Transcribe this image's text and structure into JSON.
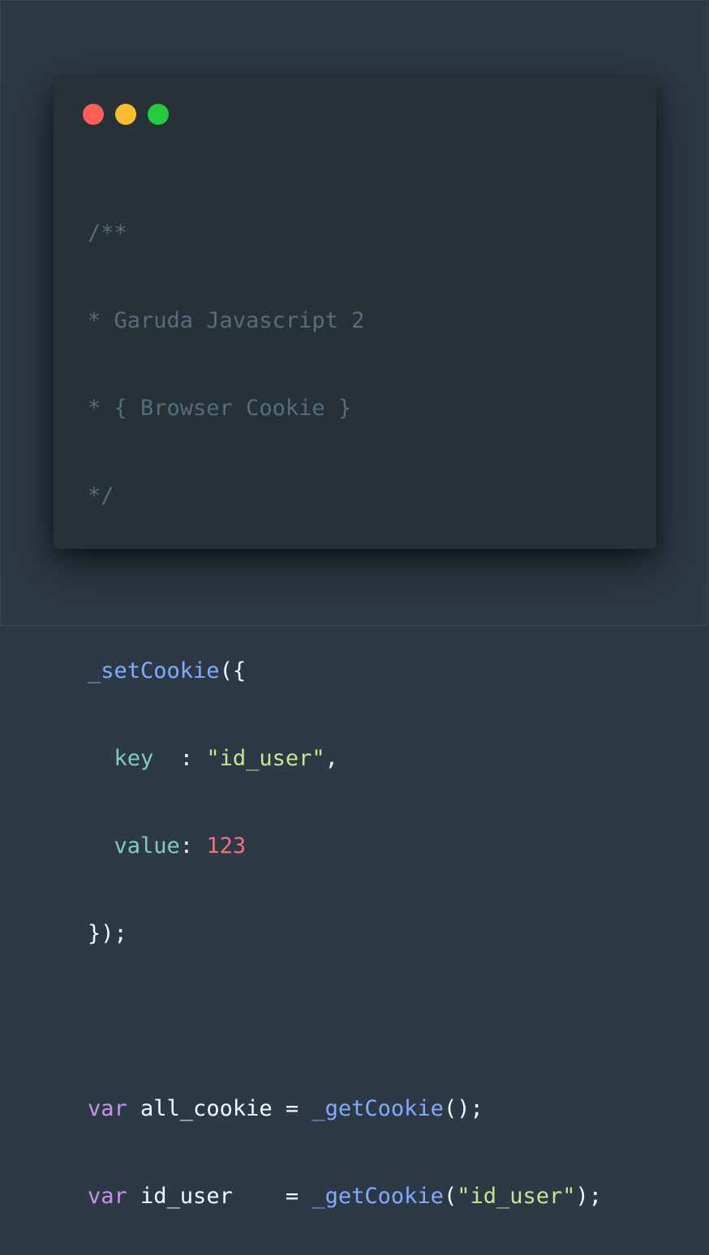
{
  "window": {
    "controls": [
      "close",
      "minimize",
      "maximize"
    ],
    "colors": {
      "close": "#ff5f56",
      "minimize": "#ffbd2e",
      "maximize": "#27c93f",
      "background": "#263238",
      "page_background": "#2e3946"
    }
  },
  "code": {
    "comment_open": "/**",
    "comment_line1": "* Garuda Javascript 2",
    "comment_line2": "* { Browser Cookie }",
    "comment_close": "*/",
    "set_fn": "_setCookie",
    "set_open": "({",
    "key_prop": "key",
    "key_colon": "  : ",
    "key_value": "\"id_user\"",
    "key_comma": ",",
    "value_prop": "value",
    "value_colon": ": ",
    "value_value": "123",
    "set_close": "});",
    "kw1": "var",
    "var1_name": " all_cookie ",
    "eq1": "= ",
    "get_fn1": "_getCookie",
    "call1_end": "();",
    "kw2": "var",
    "var2_name": " id_user    ",
    "eq2": "= ",
    "get_fn2": "_getCookie",
    "call2_open": "(",
    "call2_arg": "\"id_user\"",
    "call2_close": ");"
  }
}
